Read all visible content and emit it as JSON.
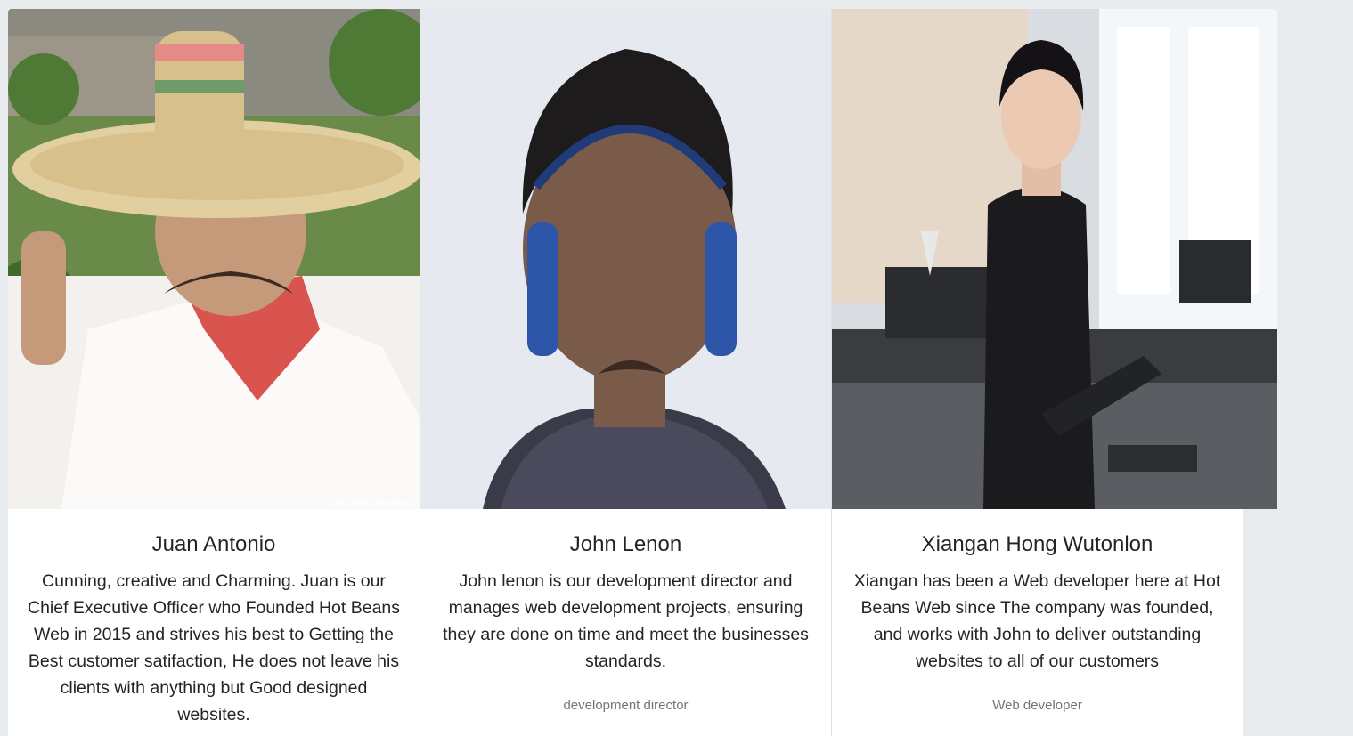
{
  "team": [
    {
      "name": "Juan Antonio",
      "bio": "Cunning, creative and Charming. Juan is our Chief Executive Officer who Founded Hot Beans Web in 2015 and strives his best to Getting the Best customer satifaction, He does not leave his clients with anything but Good designed websites.",
      "role": "",
      "photo_caption": "Handlebar Moustache",
      "photo_icon": "person-photo"
    },
    {
      "name": "John Lenon",
      "bio": "John lenon is our development director and manages web development projects, ensuring they are done on time and meet the businesses standards.",
      "role": "development director",
      "photo_icon": "person-photo"
    },
    {
      "name": "Xiangan Hong Wutonlon",
      "bio": "Xiangan has been a Web developer here at Hot Beans Web since The company was founded, and works with John to deliver outstanding websites to all of our customers",
      "role": "Web developer",
      "photo_icon": "person-photo"
    }
  ]
}
